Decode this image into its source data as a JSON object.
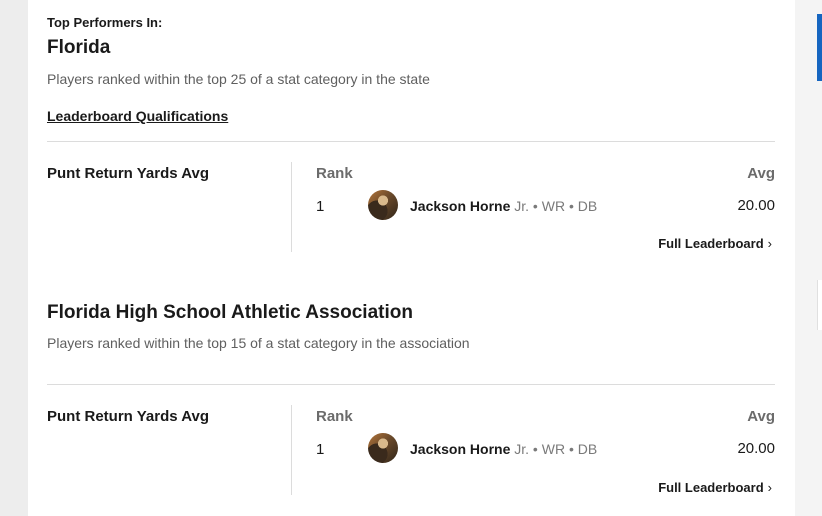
{
  "kicker": "Top Performers In:",
  "state": {
    "title": "Florida",
    "description": "Players ranked within the top 25 of a stat category in the state",
    "qualifications_link": "Leaderboard Qualifications",
    "stat": {
      "label": "Punt Return Yards Avg",
      "rank_header": "Rank",
      "avg_header": "Avg",
      "rows": [
        {
          "rank": "1",
          "name": "Jackson Horne",
          "meta": "Jr. • WR • DB",
          "avg": "20.00"
        }
      ],
      "full_link": "Full Leaderboard",
      "chevron": "›"
    }
  },
  "association": {
    "title": "Florida High School Athletic Association",
    "description": "Players ranked within the top 15 of a stat category in the association",
    "stat": {
      "label": "Punt Return Yards Avg",
      "rank_header": "Rank",
      "avg_header": "Avg",
      "rows": [
        {
          "rank": "1",
          "name": "Jackson Horne",
          "meta": "Jr. • WR • DB",
          "avg": "20.00"
        }
      ],
      "full_link": "Full Leaderboard",
      "chevron": "›"
    }
  }
}
